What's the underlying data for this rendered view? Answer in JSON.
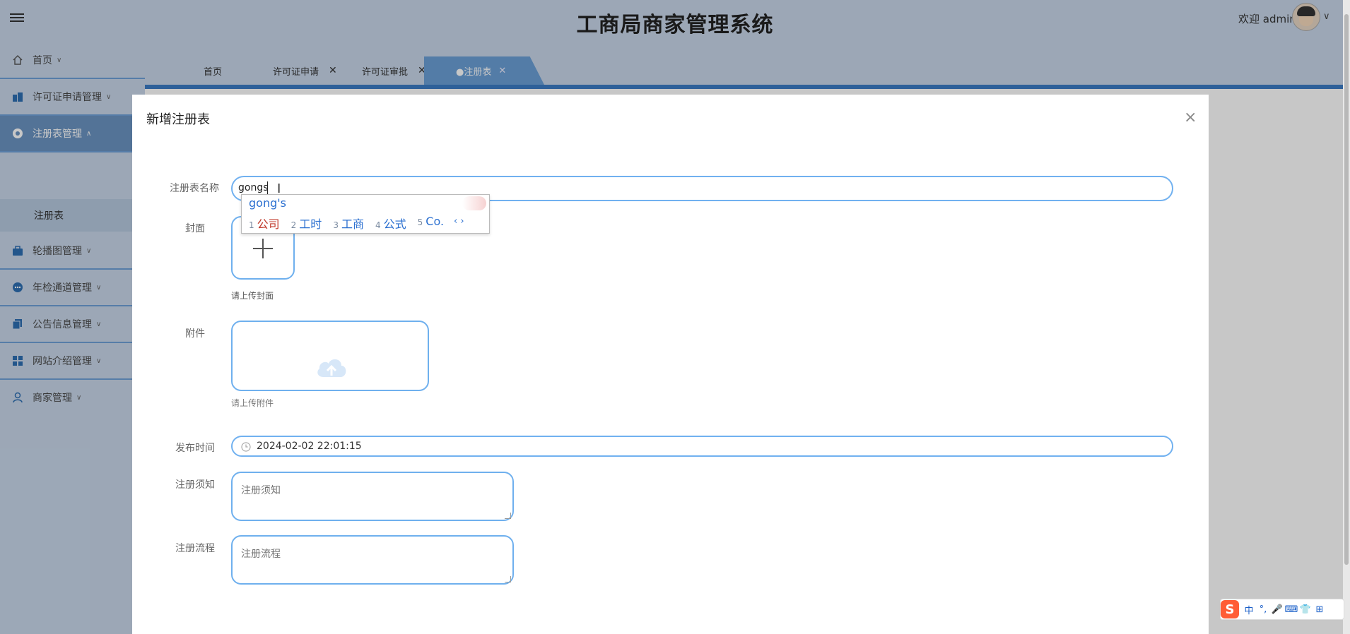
{
  "header": {
    "title": "工商局商家管理系统",
    "welcome": "欢迎 admin"
  },
  "sidebar": {
    "items": [
      {
        "label": "首页",
        "icon": "home-icon"
      },
      {
        "label": "许可证申请管理",
        "icon": "building-icon"
      },
      {
        "label": "注册表管理",
        "icon": "circle-dot-icon",
        "active": true
      },
      {
        "label": "轮播图管理",
        "icon": "briefcase-icon"
      },
      {
        "label": "年检通道管理",
        "icon": "dots-circle-icon"
      },
      {
        "label": "公告信息管理",
        "icon": "copy-icon"
      },
      {
        "label": "网站介绍管理",
        "icon": "grid-icon"
      },
      {
        "label": "商家管理",
        "icon": "user-icon"
      }
    ],
    "submenu": {
      "label": "注册表"
    }
  },
  "tabs": [
    {
      "label": "首页",
      "closable": false
    },
    {
      "label": "许可证申请",
      "closable": true
    },
    {
      "label": "许可证审批",
      "closable": true
    },
    {
      "label": "●注册表",
      "closable": true,
      "active": true
    }
  ],
  "modal": {
    "title": "新增注册表",
    "fields": {
      "name": {
        "label": "注册表名称",
        "value": "gongs"
      },
      "cover": {
        "label": "封面",
        "hint": "请上传封面"
      },
      "attachment": {
        "label": "附件",
        "hint": "请上传附件"
      },
      "publish_time": {
        "label": "发布时间",
        "value": "2024-02-02 22:01:15"
      },
      "notice": {
        "label": "注册须知",
        "placeholder": "注册须知"
      },
      "process": {
        "label": "注册流程",
        "placeholder": "注册流程"
      }
    }
  },
  "ime": {
    "composition": "gong's",
    "candidates": [
      {
        "num": "1",
        "text": "公司"
      },
      {
        "num": "2",
        "text": "工时"
      },
      {
        "num": "3",
        "text": "工商"
      },
      {
        "num": "4",
        "text": "公式"
      },
      {
        "num": "5",
        "text": "Co."
      }
    ],
    "nav": "‹ ›"
  },
  "toolbar": {
    "logo": "S",
    "items": [
      "中",
      "°,",
      "🎤",
      "⌨",
      "👕",
      "⊞"
    ]
  },
  "colors": {
    "header_bg": "#c8d7ea",
    "accent": "#3c7bc4",
    "input_border": "#71b1f0",
    "ime_selected": "#c0392b"
  }
}
